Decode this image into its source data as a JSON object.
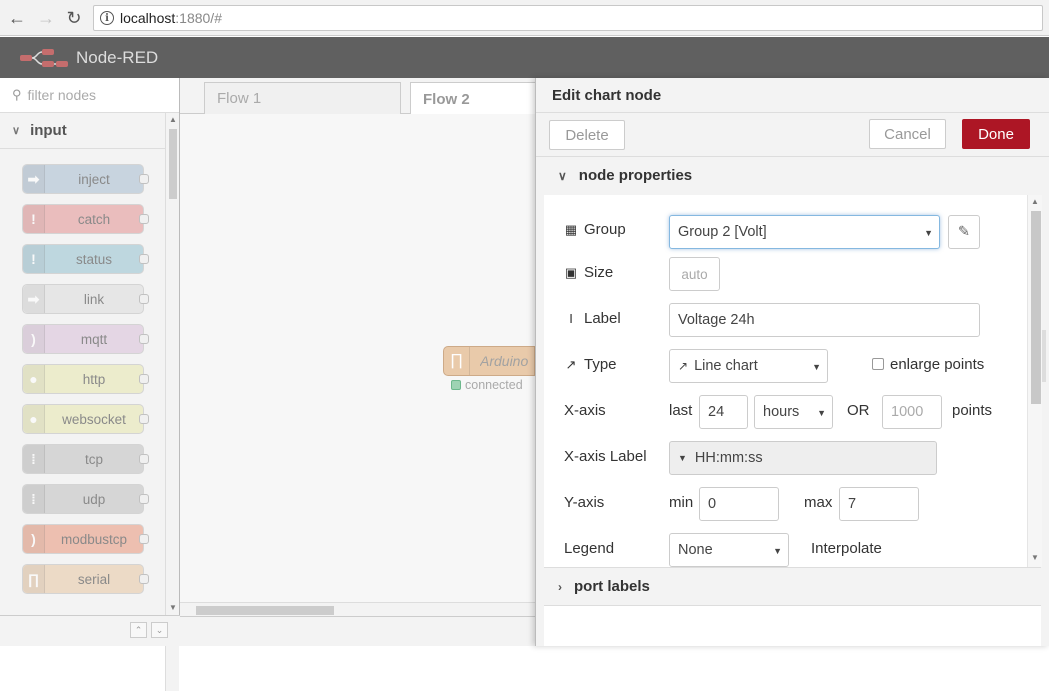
{
  "browser": {
    "back_icon": "arrow-left-icon",
    "forward_icon": "arrow-right-icon",
    "reload_icon": "reload-icon",
    "url_host": "localhost",
    "url_rest": ":1880/#"
  },
  "app": {
    "title": "Node-RED",
    "header_color": "#606060"
  },
  "palette": {
    "search_placeholder": "filter nodes",
    "category": "input",
    "nodes": [
      {
        "label": "inject",
        "color": "#a6bbcf"
      },
      {
        "label": "catch",
        "color": "#e49191"
      },
      {
        "label": "status",
        "color": "#94c1d0"
      },
      {
        "label": "link",
        "color": "#dddddd"
      },
      {
        "label": "mqtt",
        "color": "#d8bfd8"
      },
      {
        "label": "http",
        "color": "#e7e7ae"
      },
      {
        "label": "websocket",
        "color": "#e7e7ae"
      },
      {
        "label": "tcp",
        "color": "#c0c0c0"
      },
      {
        "label": "udp",
        "color": "#c0c0c0"
      },
      {
        "label": "modbustcp",
        "color": "#e9967a"
      },
      {
        "label": "serial",
        "color": "#e8c6a2"
      }
    ]
  },
  "workspace": {
    "tabs": [
      "Flow 1",
      "Flow 2"
    ],
    "node_label": "Arduino",
    "node_status": "connected"
  },
  "tray": {
    "title": "Edit chart node",
    "delete_label": "Delete",
    "cancel_label": "Cancel",
    "done_label": "Done",
    "section_properties": "node properties",
    "section_port_labels": "port labels",
    "fields": {
      "group_label": "Group",
      "group_value": "Group 2 [Volt]",
      "size_label": "Size",
      "size_value": "auto",
      "label_label": "Label",
      "label_value": "Voltage  24h",
      "type_label": "Type",
      "type_value": "Line chart",
      "enlarge_label": "enlarge points",
      "xaxis_label": "X-axis",
      "xaxis_last": "last",
      "xaxis_value": "24",
      "xaxis_unit": "hours",
      "xaxis_or": "OR",
      "xaxis_points_placeholder": "1000",
      "xaxis_points": "points",
      "xaxis_label_label": "X-axis Label",
      "xaxis_label_value": "HH:mm:ss",
      "yaxis_label": "Y-axis",
      "yaxis_min_label": "min",
      "yaxis_min": "0",
      "yaxis_max_label": "max",
      "yaxis_max": "7",
      "legend_label": "Legend",
      "legend_value": "None",
      "interpolate_label": "Interpolate"
    },
    "done_color": "#ad1625"
  }
}
